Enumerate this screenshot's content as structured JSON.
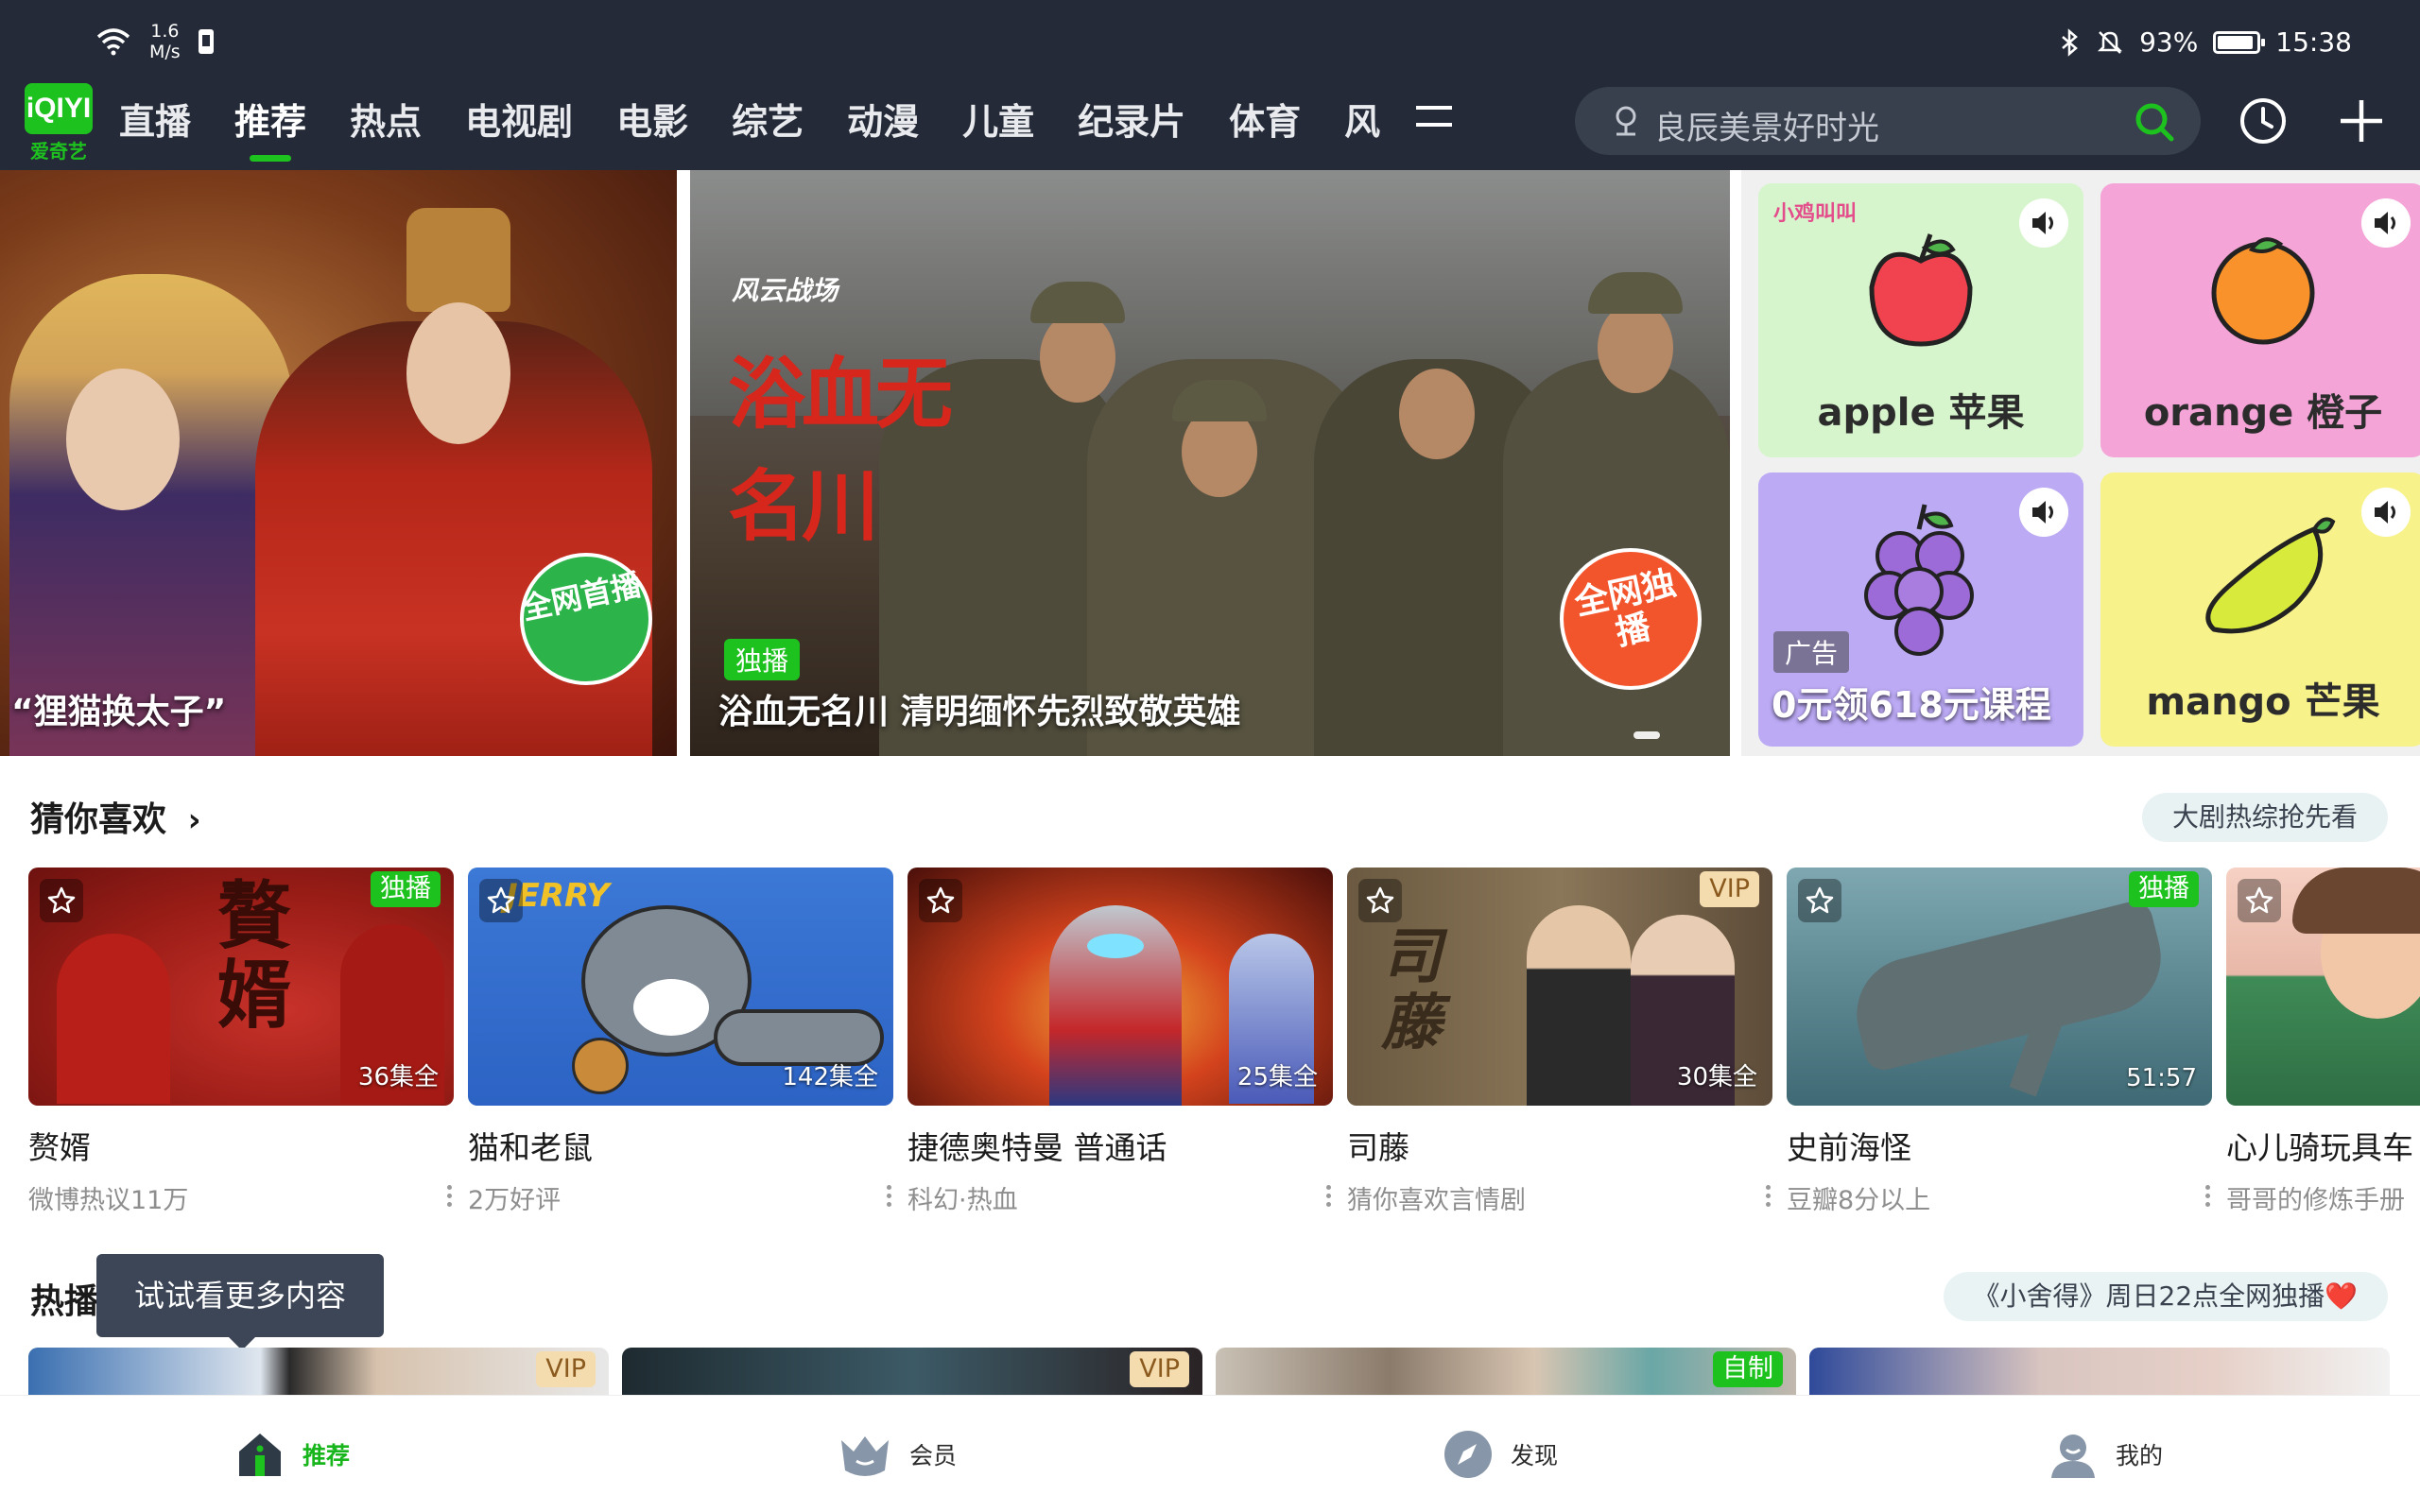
{
  "status_bar": {
    "net_speed_value": "1.6",
    "net_speed_unit": "M/s",
    "battery": "93%",
    "time": "15:38"
  },
  "app": {
    "logo_text": "iQIYI",
    "logo_sub": "爱奇艺",
    "brand_color": "#1ec21f"
  },
  "nav": {
    "items": [
      {
        "label": "直播"
      },
      {
        "label": "推荐"
      },
      {
        "label": "热点"
      },
      {
        "label": "电视剧"
      },
      {
        "label": "电影"
      },
      {
        "label": "综艺"
      },
      {
        "label": "动漫"
      },
      {
        "label": "儿童"
      },
      {
        "label": "纪录片"
      },
      {
        "label": "体育"
      },
      {
        "label": "风"
      }
    ],
    "active": "推荐"
  },
  "search": {
    "placeholder": "良辰美景好时光"
  },
  "banner": {
    "slide1": {
      "caption": "“狸猫换太子”",
      "badge": "全网首播"
    },
    "slide2": {
      "tag": "独播",
      "caption": "浴血无名川 清明缅怀先烈致敬英雄",
      "art_title": "浴血无名川",
      "art_sub": "风云战场",
      "badge": "全网独播"
    },
    "ad": {
      "brand": "小鸡叫叫",
      "tag": "广告",
      "caption": "0元领618元课程",
      "tiles": [
        {
          "en": "apple",
          "zh": "苹果",
          "color": "#d7f5cd"
        },
        {
          "en": "orange",
          "zh": "橙子",
          "color": "#f5a4d8"
        },
        {
          "en": "grape",
          "zh": "葡萄",
          "color": "#bcaaf5"
        },
        {
          "en": "mango",
          "zh": "芒果",
          "color": "#f7f28a"
        }
      ]
    }
  },
  "guess": {
    "title": "猜你喜欢",
    "chip": "大剧热综抢先看",
    "cards": [
      {
        "title": "赘婿",
        "sub": "微博热议11万",
        "mark": "独播",
        "mark_type": "green",
        "dur": "36集全"
      },
      {
        "title": "猫和老鼠",
        "sub": "2万好评",
        "mark": "",
        "mark_type": "",
        "dur": "142集全"
      },
      {
        "title": "捷德奥特曼 普通话",
        "sub": "科幻·热血",
        "mark": "",
        "mark_type": "",
        "dur": "25集全"
      },
      {
        "title": "司藤",
        "sub": "猜你喜欢言情剧",
        "mark": "VIP",
        "mark_type": "vip",
        "dur": "30集全"
      },
      {
        "title": "史前海怪",
        "sub": "豆瓣8分以上",
        "mark": "独播",
        "mark_type": "green",
        "dur": "51:57"
      },
      {
        "title": "心儿骑玩具车",
        "sub": "哥哥的修炼手册",
        "mark": "",
        "mark_type": "",
        "dur": ""
      }
    ]
  },
  "hot": {
    "title": "热播",
    "chip": "《小舍得》周日22点全网独播❤️",
    "tooltip": "试试看更多内容",
    "marks": [
      "VIP",
      "VIP",
      "自制",
      ""
    ]
  },
  "tabbar": {
    "items": [
      {
        "label": "推荐",
        "icon": "home-icon"
      },
      {
        "label": "会员",
        "icon": "crown-icon"
      },
      {
        "label": "发现",
        "icon": "compass-icon"
      },
      {
        "label": "我的",
        "icon": "profile-icon"
      }
    ],
    "active": "推荐"
  }
}
